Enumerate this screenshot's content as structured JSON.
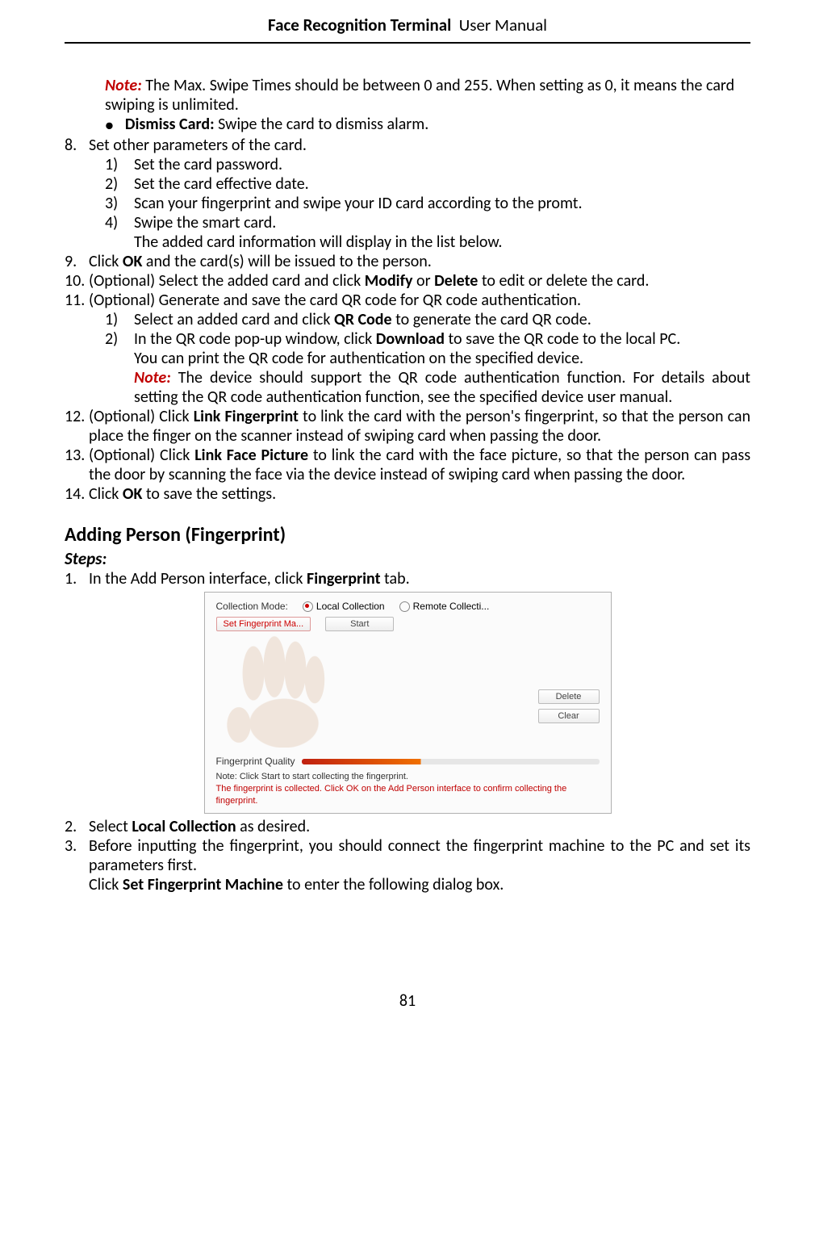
{
  "header": {
    "title_left": "Face Recognition Terminal",
    "title_right": "User Manual"
  },
  "page_number": "81",
  "top_note": {
    "label": "Note:",
    "text": " The Max. Swipe Times should be between 0 and 255. When setting as 0, it means the card swiping is unlimited."
  },
  "dismiss": {
    "label": "Dismiss Card:",
    "text": " Swipe the card to dismiss alarm."
  },
  "items": {
    "8": "Set other parameters of the card.",
    "8_1": "Set the card password.",
    "8_2": "Set the card effective date.",
    "8_3": "Scan your fingerprint and swipe your ID card according to the promt.",
    "8_4": "Swipe the smart card.",
    "8_4_follow": "The added card information will display in the list below.",
    "9_pre": "Click ",
    "9_b": "OK",
    "9_post": " and the card(s) will be issued to the person.",
    "10_pre": "(Optional) Select the added card and click ",
    "10_b1": "Modify",
    "10_mid": " or ",
    "10_b2": "Delete",
    "10_post": " to edit or delete the card.",
    "11": "(Optional) Generate and save the card QR code for QR code authentication.",
    "11_1_pre": "Select an added card and click ",
    "11_1_b": "QR Code",
    "11_1_post": " to generate the card QR code.",
    "11_2_pre": "In the QR code pop-up window, click ",
    "11_2_b": "Download",
    "11_2_post": " to save the QR code to the local PC.",
    "11_2_follow": "You can print the QR code for authentication on the specified device.",
    "11_note_label": "Note:",
    "11_note_text": " The device should support the QR code authentication function. For details about setting the QR code authentication function, see the specified device user manual.",
    "12_pre": "(Optional) Click ",
    "12_b": "Link Fingerprint",
    "12_post": " to link the card with the person's fingerprint, so that the person can place the finger on the scanner instead of swiping card when passing the door.",
    "13_pre": "(Optional) Click ",
    "13_b": "Link Face Picture",
    "13_post": " to link the card with the face picture, so that the person can pass the door by scanning the face via the device instead of swiping card when passing the door.",
    "14_pre": "Click ",
    "14_b": "OK",
    "14_post": " to save the settings."
  },
  "heading2": "Adding Person (Fingerprint)",
  "steps_label": "Steps:",
  "steps": {
    "1_pre": "In the Add Person interface, click ",
    "1_b": "Fingerprint",
    "1_post": " tab.",
    "2_pre": "Select ",
    "2_b": "Local Collection",
    "2_post": " as desired.",
    "3_line1": "Before inputting the fingerprint, you should connect the fingerprint machine to the PC and set its parameters first.",
    "3_line2_pre": "Click ",
    "3_line2_b": "Set Fingerprint Machine",
    "3_line2_post": " to enter the following dialog box."
  },
  "screenshot": {
    "collection_mode": "Collection Mode:",
    "local": "Local Collection",
    "remote": "Remote Collecti...",
    "set_btn": "Set Fingerprint Ma...",
    "start_btn": "Start",
    "delete_btn": "Delete",
    "clear_btn": "Clear",
    "fq_label": "Fingerprint Quality",
    "note1": "Note: Click Start to start collecting the fingerprint.",
    "note2": "The fingerprint is collected. Click OK on the Add Person interface to confirm collecting the fingerprint."
  }
}
